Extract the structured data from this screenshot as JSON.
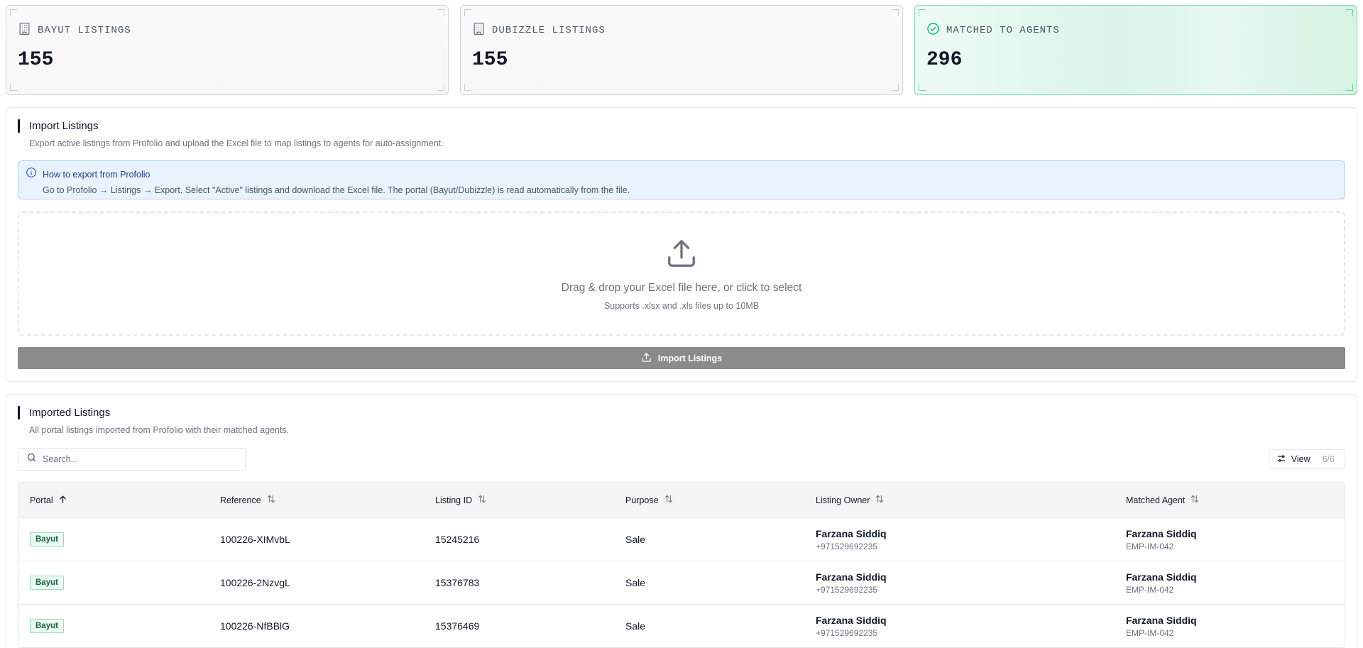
{
  "stats": [
    {
      "label": "BAYUT LISTINGS",
      "value": "155",
      "icon": "building-icon"
    },
    {
      "label": "DUBIZZLE LISTINGS",
      "value": "155",
      "icon": "building-icon"
    },
    {
      "label": "MATCHED TO AGENTS",
      "value": "296",
      "icon": "check-circle-icon",
      "accent": "#10b981"
    }
  ],
  "import_section": {
    "title": "Import Listings",
    "subtitle": "Export active listings from Profolio and upload the Excel file to map listings to agents for auto-assignment.",
    "info_title": "How to export from Profolio",
    "info_text": "Go to Profolio → Listings → Export. Select \"Active\" listings and download the Excel file. The portal (Bayut/Dubizzle) is read automatically from the file.",
    "drop_title": "Drag & drop your Excel file here, or click to select",
    "drop_sub": "Supports .xlsx and .xls files up to 10MB",
    "button_label": "Import Listings"
  },
  "imported_section": {
    "title": "Imported Listings",
    "subtitle": "All portal listings imported from Profolio with their matched agents.",
    "search_placeholder": "Search...",
    "view_label": "View",
    "view_count": "6/6",
    "columns": [
      "Portal",
      "Reference",
      "Listing ID",
      "Purpose",
      "Listing Owner",
      "Matched Agent"
    ],
    "rows": [
      {
        "portal": "Bayut",
        "reference": "100226-XIMvbL",
        "listing_id": "15245216",
        "purpose": "Sale",
        "owner_name": "Farzana Siddiq",
        "owner_phone": "+971529692235",
        "agent_name": "Farzana Siddiq",
        "agent_id": "EMP-IM-042"
      },
      {
        "portal": "Bayut",
        "reference": "100226-2NzvgL",
        "listing_id": "15376783",
        "purpose": "Sale",
        "owner_name": "Farzana Siddiq",
        "owner_phone": "+971529692235",
        "agent_name": "Farzana Siddiq",
        "agent_id": "EMP-IM-042"
      },
      {
        "portal": "Bayut",
        "reference": "100226-NfBBlG",
        "listing_id": "15376469",
        "purpose": "Sale",
        "owner_name": "Farzana Siddiq",
        "owner_phone": "+971529692235",
        "agent_name": "Farzana Siddiq",
        "agent_id": "EMP-IM-042"
      }
    ]
  },
  "colors": {
    "info_bg": "#e9f3fd",
    "badge_green": "#166534",
    "button_gray": "#8b8b8b"
  }
}
